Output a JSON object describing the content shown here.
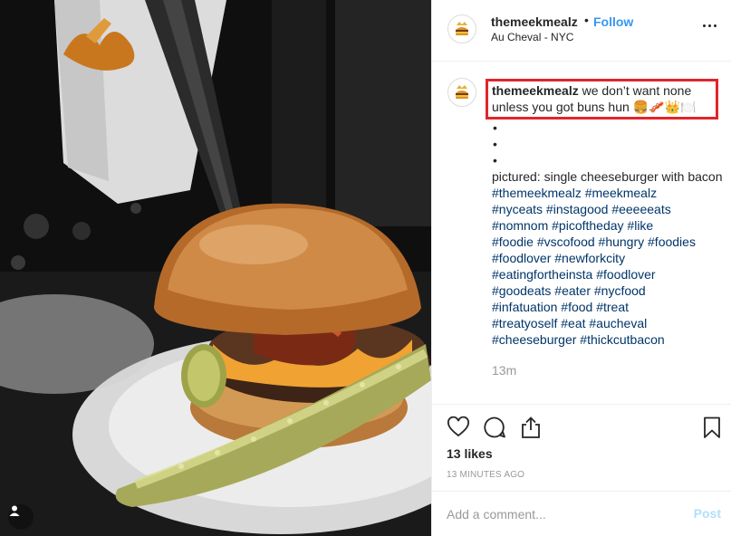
{
  "post": {
    "username": "themeekmealz",
    "separator": "•",
    "follow_label": "Follow",
    "location": "Au Cheval - NYC",
    "avatar_label": "the MEAL",
    "more_icon": "more-options-icon"
  },
  "caption": {
    "username": "themeekmealz",
    "text": "we don’t want none unless you got buns hun 🍔🥓👑🍽️",
    "bullets": [
      "•",
      "•",
      "•"
    ],
    "pictured": "pictured: single cheeseburger with bacon",
    "hashtags": [
      "#themeekmealz #meekmealz",
      "#nyceats #instagood #eeeeeats",
      "#nomnom #picoftheday #like",
      "#foodie #vscofood #hungry #foodies",
      "#foodlover #newforkcity",
      "#eatingfortheinsta #foodlover",
      "#goodeats #eater #nycfood",
      "#infatuation #food #treat",
      "#treatyoself #eat #aucheval",
      "#cheeseburger #thickcutbacon"
    ],
    "time": "13m"
  },
  "actions": {
    "icons": [
      "heart-icon",
      "comment-icon",
      "share-icon",
      "bookmark-icon"
    ],
    "likes": "13 likes",
    "ago": "13 MINUTES AGO"
  },
  "comment": {
    "placeholder": "Add a comment...",
    "post_label": "Post"
  },
  "colors": {
    "link": "#3897f0",
    "hashtag": "#003569",
    "highlight_border": "#e0262a",
    "post_disabled": "#b2dffc"
  }
}
